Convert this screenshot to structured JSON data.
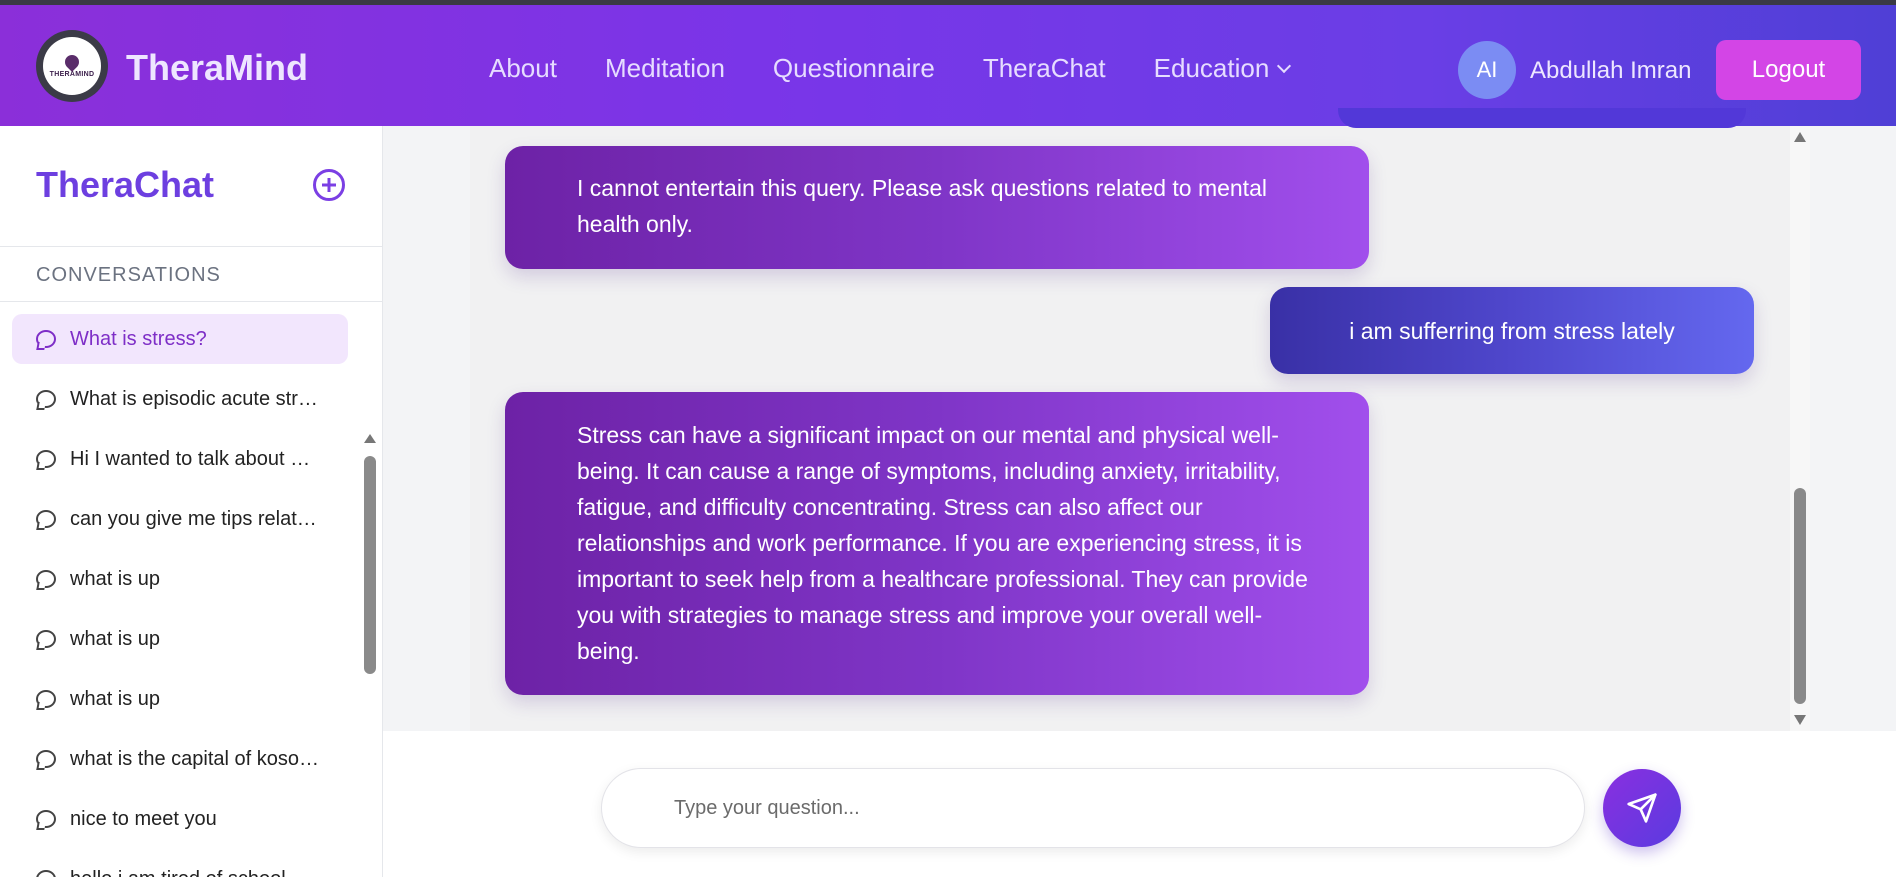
{
  "app": {
    "brand": "TheraMind",
    "logo_text": "THERAMIND"
  },
  "header": {
    "nav": [
      {
        "label": "About"
      },
      {
        "label": "Meditation"
      },
      {
        "label": "Questionnaire"
      },
      {
        "label": "TheraChat"
      },
      {
        "label": "Education"
      }
    ],
    "user": {
      "initials": "AI",
      "name": "Abdullah Imran"
    },
    "logout_label": "Logout"
  },
  "sidebar": {
    "title": "TheraChat",
    "section_label": "CONVERSATIONS",
    "conversations": [
      {
        "label": "What is stress?",
        "active": true
      },
      {
        "label": "What is episodic acute stress?"
      },
      {
        "label": "Hi I wanted to talk about my anxiety"
      },
      {
        "label": "can you give me tips related to stress"
      },
      {
        "label": "what is up"
      },
      {
        "label": "what is up"
      },
      {
        "label": "what is up"
      },
      {
        "label": "what is the capital of kosovo"
      },
      {
        "label": "nice to meet you"
      },
      {
        "label": "hello i am tired of school"
      }
    ]
  },
  "chat": {
    "messages": [
      {
        "role": "bot",
        "text": "I cannot entertain this query. Please ask questions related to mental health only."
      },
      {
        "role": "user",
        "text": "i am sufferring from stress lately"
      },
      {
        "role": "bot",
        "text": "Stress can have a significant impact on our mental and physical well-being. It can cause a range of symptoms, including anxiety, irritability, fatigue, and difficulty concentrating. Stress can also affect our relationships and work performance. If you are experiencing stress, it is important to seek help from a healthcare professional. They can provide you with strategies to manage stress and improve your overall well-being."
      }
    ],
    "input_placeholder": "Type your question..."
  },
  "colors": {
    "header_start": "#8b2fd9",
    "header_end": "#4f3fd6",
    "logout": "#d345e6",
    "bot_bubble": "#7f35c7",
    "user_bubble": "#4f47cc",
    "accent": "#6d3fe0"
  },
  "icons": {
    "add_chat": "plus-circle-icon",
    "conversation": "chat-bubble-icon",
    "dropdown": "chevron-down-icon",
    "send": "paper-plane-icon"
  }
}
